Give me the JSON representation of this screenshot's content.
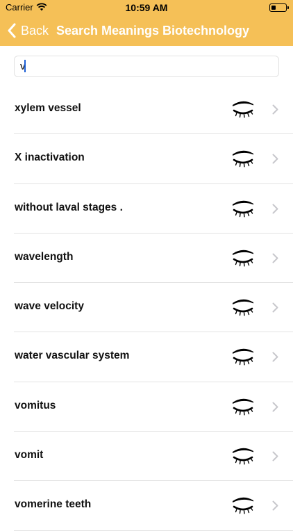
{
  "status_bar": {
    "carrier": "Carrier",
    "time": "10:59 AM",
    "battery_level": 0.3,
    "icons": [
      "wifi-icon",
      "battery-icon"
    ]
  },
  "nav": {
    "back_label": "Back",
    "title": "Search Meanings Biotechnology",
    "background_color": "#f5c057",
    "text_color": "#ffffff"
  },
  "search": {
    "value": "v",
    "placeholder": ""
  },
  "list": {
    "items": [
      {
        "label": "xylem vessel",
        "icon": "closed-eye-icon"
      },
      {
        "label": "X inactivation",
        "icon": "closed-eye-icon"
      },
      {
        "label": "without laval stages .",
        "icon": "closed-eye-icon"
      },
      {
        "label": "wavelength",
        "icon": "closed-eye-icon"
      },
      {
        "label": "wave velocity",
        "icon": "closed-eye-icon"
      },
      {
        "label": "water vascular system",
        "icon": "closed-eye-icon"
      },
      {
        "label": "vomitus",
        "icon": "closed-eye-icon"
      },
      {
        "label": "vomit",
        "icon": "closed-eye-icon"
      },
      {
        "label": "vomerine teeth",
        "icon": "closed-eye-icon"
      }
    ],
    "accessory_icon": "chevron-right-icon"
  }
}
